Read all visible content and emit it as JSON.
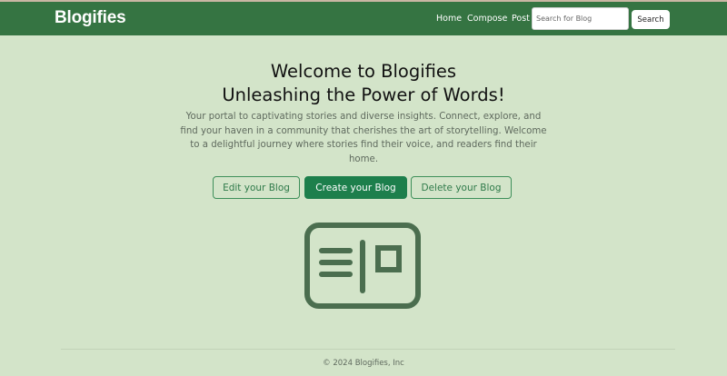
{
  "navbar": {
    "brand": "Blogifies",
    "links": [
      "Home",
      "Compose",
      "Post"
    ],
    "search": {
      "placeholder": "Search for Blog",
      "value": "",
      "button_label": "Search"
    },
    "background_color": "#357442"
  },
  "hero": {
    "title_line1": "Welcome to Blogifies",
    "title_line2": "Unleashing the Power of Words!",
    "description": "Your portal to captivating stories and diverse insights. Connect, explore, and find your haven in a community that cherishes the art of storytelling. Welcome to a delightful journey where stories find their voice, and readers find their home.",
    "buttons": {
      "edit": "Edit your Blog",
      "create": "Create your Blog",
      "delete": "Delete your Blog"
    },
    "icon": "blog-newspaper-icon"
  },
  "footer": {
    "copyright": "© 2024 Blogifies, Inc"
  },
  "colors": {
    "page_background": "#d3e4c9",
    "accent": "#1d7f4c",
    "icon": "#4b6e4f"
  }
}
